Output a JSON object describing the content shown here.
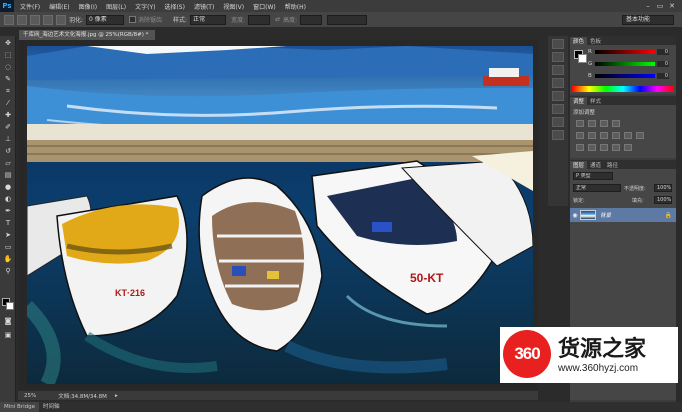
{
  "app": {
    "logo": "Ps"
  },
  "menu": {
    "items": [
      "文件(F)",
      "编辑(E)",
      "图像(I)",
      "图层(L)",
      "文字(Y)",
      "选择(S)",
      "滤镜(T)",
      "视图(V)",
      "窗口(W)",
      "帮助(H)"
    ]
  },
  "window_controls": {
    "minimize": "–",
    "restore": "▭",
    "close": "✕"
  },
  "options": {
    "feather_label": "羽化:",
    "feather_value": "0 像素",
    "antialias_label": "消除锯齿",
    "style_label": "样式:",
    "style_value": "正常",
    "width_label": "宽度:",
    "height_label": "高度:",
    "workspace": "基本功能"
  },
  "document": {
    "tab_title": "千库网_海边艺术文化海报.jpg @ 25%(RGB/8#) *",
    "zoom": "25%",
    "doc_info": "文档:34.8M/34.8M"
  },
  "bottom_tabs": [
    "Mini Bridge",
    "时间轴"
  ],
  "panels": {
    "color_tabs": [
      "颜色",
      "色板"
    ],
    "color_sliders": [
      {
        "label": "R",
        "value": "0"
      },
      {
        "label": "G",
        "value": "0"
      },
      {
        "label": "B",
        "value": "0"
      }
    ],
    "adjust_tabs": [
      "调整",
      "样式"
    ],
    "adjust_title": "添加调整",
    "layers_tabs": [
      "图层",
      "通道",
      "路径"
    ],
    "kind_label": "P 类型",
    "blend_mode": "正常",
    "opacity_label": "不透明度:",
    "opacity_value": "100%",
    "lock_label": "锁定:",
    "fill_label": "填充:",
    "fill_value": "100%",
    "layer_name": "背景"
  },
  "watermark": {
    "logo_text": "360",
    "title": "货源之家",
    "url": "www.360hyzj.com"
  },
  "colors": {
    "accent_selection": "#5d7aa5",
    "watermark_red": "#e8201f"
  }
}
